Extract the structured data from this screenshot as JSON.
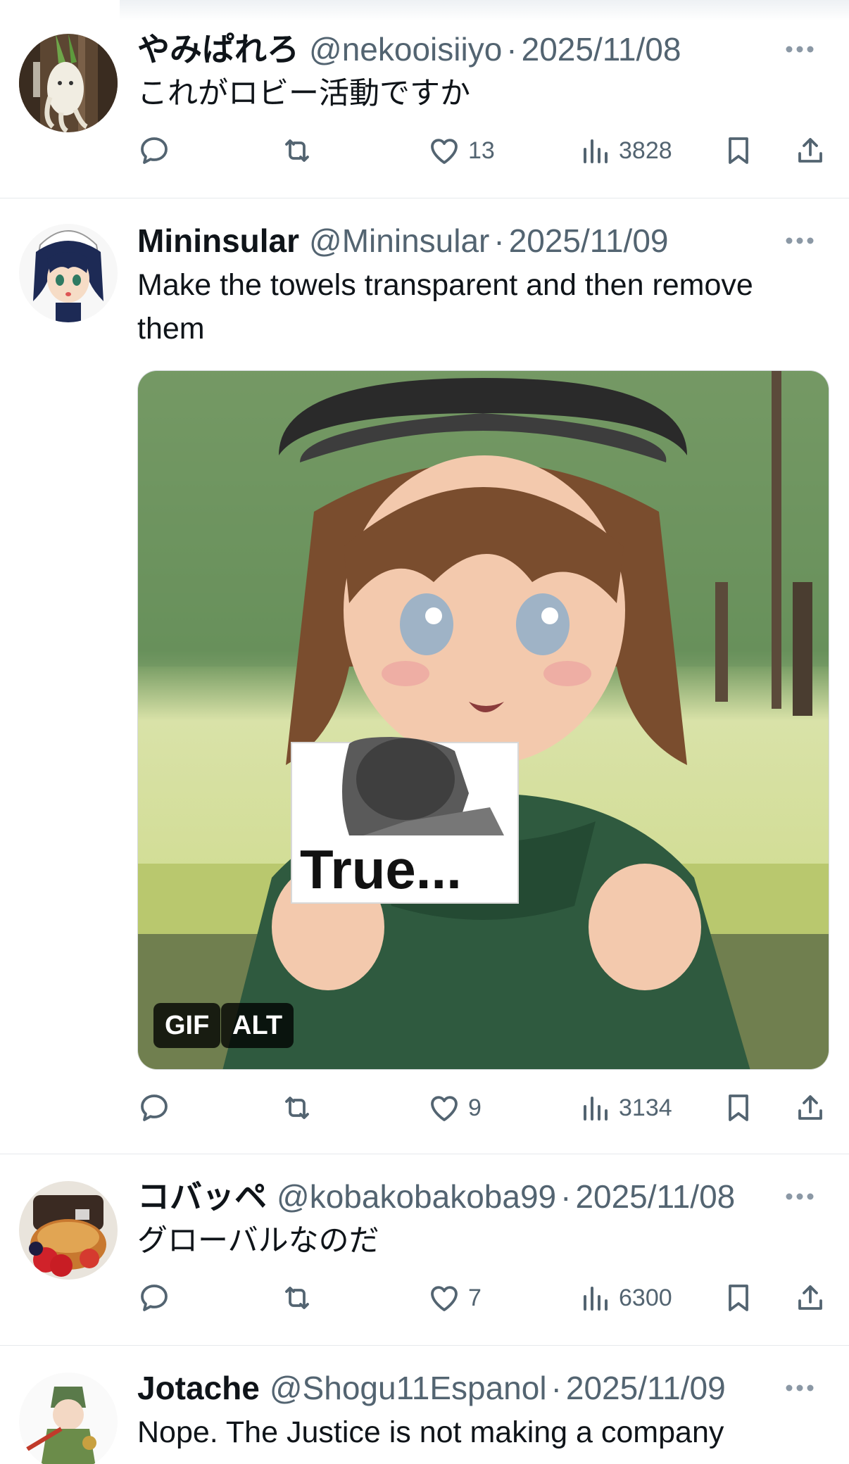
{
  "tweets": [
    {
      "username": "やみぱれろ",
      "handle": "@nekooisiiyo",
      "separator": "·",
      "date": "2025/11/08",
      "text": "これがロビー活動ですか",
      "likes": "13",
      "views": "3828"
    },
    {
      "username": "Mininsular",
      "handle": "@Mininsular",
      "separator": "·",
      "date": "2025/11/09",
      "text": "Make the towels transparent and then remove them",
      "media": {
        "caption": "True...",
        "gif_badge": "GIF",
        "alt_badge": "ALT"
      },
      "likes": "9",
      "views": "3134"
    },
    {
      "username": "コバッペ",
      "handle": "@kobakobakoba99",
      "separator": "·",
      "date": "2025/11/08",
      "text": "グローバルなのだ",
      "likes": "7",
      "views": "6300"
    },
    {
      "username": "Jotache",
      "handle": "@Shogu11Espanol",
      "separator": "·",
      "date": "2025/11/09",
      "text": "Nope. The Justice is not making a company"
    }
  ],
  "icons": {
    "reply": "reply-icon",
    "repost": "repost-icon",
    "like": "like-icon",
    "views": "views-icon",
    "bookmark": "bookmark-icon",
    "share": "share-icon",
    "more": "more-icon"
  },
  "colors": {
    "text": "#0f1419",
    "secondary": "#536471",
    "divider": "#e6e9ec"
  }
}
